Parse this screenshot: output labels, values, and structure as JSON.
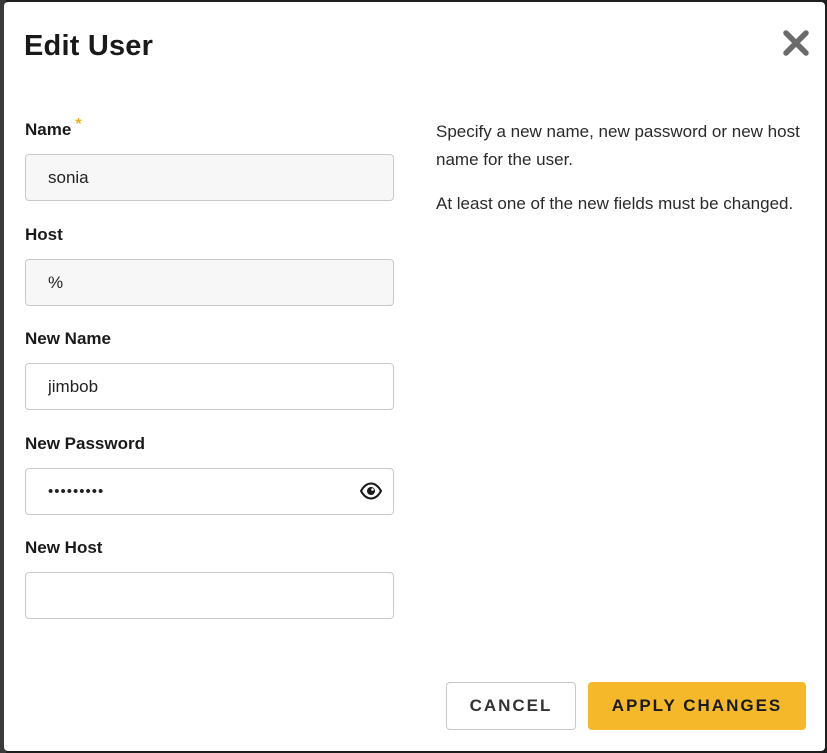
{
  "dialog": {
    "title": "Edit User",
    "close_icon": "close-icon"
  },
  "form": {
    "name": {
      "label": "Name",
      "required_mark": "*",
      "value": "sonia"
    },
    "host": {
      "label": "Host",
      "value": "%"
    },
    "new_name": {
      "label": "New Name",
      "value": "jimbob"
    },
    "new_password": {
      "label": "New Password",
      "value": "•••••••••",
      "reveal_icon": "eye-icon"
    },
    "new_host": {
      "label": "New Host",
      "value": ""
    }
  },
  "help": {
    "paragraph_1": "Specify a new name, new password or new host name for the user.",
    "paragraph_2": "At least one of the new fields must be changed."
  },
  "buttons": {
    "cancel": "CANCEL",
    "apply": "APPLY CHANGES"
  },
  "colors": {
    "accent": "#f5b82a",
    "required": "#f2b01e"
  }
}
